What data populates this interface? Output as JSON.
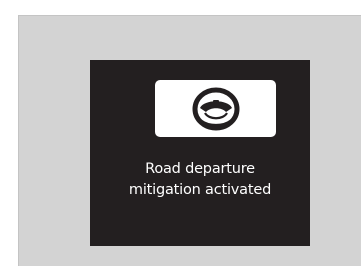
{
  "notification": {
    "icon": "steering-wheel-icon",
    "line1": "Road departure",
    "line2": "mitigation activated"
  },
  "colors": {
    "outer_background": "#d3d3d3",
    "display_background": "#231f20",
    "icon_box": "#ffffff",
    "icon_fill": "#231f20",
    "text": "#ffffff"
  }
}
